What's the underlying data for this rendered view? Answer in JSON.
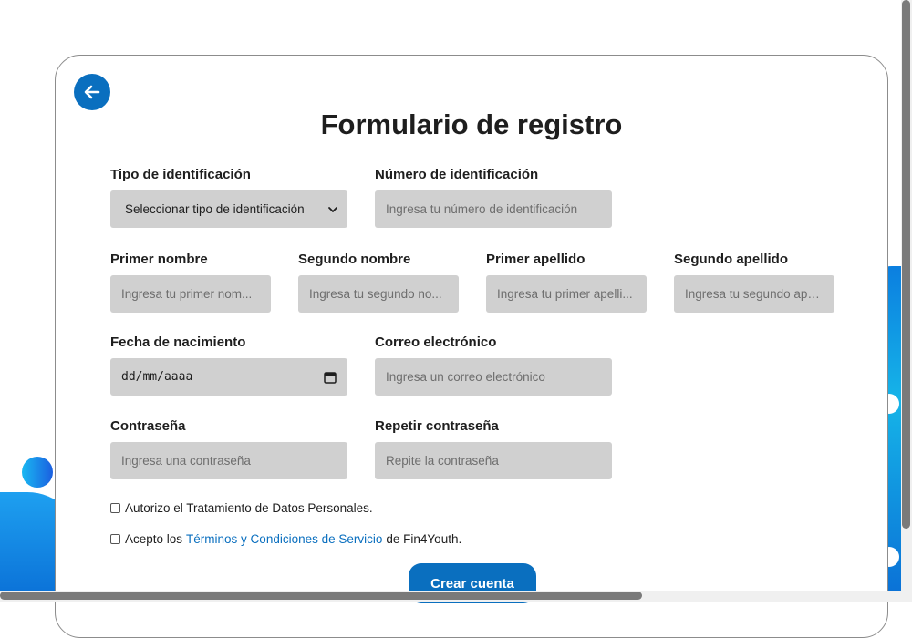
{
  "form": {
    "title": "Formulario de registro",
    "back_icon": "arrow-left-icon",
    "fields": {
      "id_type": {
        "label": "Tipo de identificación",
        "value": "Seleccionar tipo de identificación"
      },
      "id_number": {
        "label": "Número de identificación",
        "placeholder": "Ingresa tu número de identificación"
      },
      "first_name": {
        "label": "Primer nombre",
        "placeholder": "Ingresa tu primer nom..."
      },
      "second_name": {
        "label": "Segundo nombre",
        "placeholder": "Ingresa tu segundo no..."
      },
      "first_surname": {
        "label": "Primer apellido",
        "placeholder": "Ingresa tu primer apelli..."
      },
      "second_surname": {
        "label": "Segundo apellido",
        "placeholder": "Ingresa tu segundo ape..."
      },
      "birth_date": {
        "label": "Fecha de nacimiento",
        "value": "dd/mm/aaaa"
      },
      "email": {
        "label": "Correo electrónico",
        "placeholder": "Ingresa un correo electrónico"
      },
      "password": {
        "label": "Contraseña",
        "placeholder": "Ingresa una contraseña"
      },
      "password_repeat": {
        "label": "Repetir contraseña",
        "placeholder": "Repite la contraseña"
      }
    },
    "consent_data": "Autorizo el Tratamiento de Datos Personales.",
    "terms": {
      "prefix": "Acepto los",
      "link": "Términos y Condiciones de Servicio",
      "suffix": "de Fin4Youth."
    },
    "submit_label": "Crear cuenta"
  },
  "colors": {
    "accent": "#0a6fbf",
    "input_bg": "#d0d0d0",
    "deco_blue": "#0a6fd6",
    "deco_cyan": "#16b4e8"
  }
}
